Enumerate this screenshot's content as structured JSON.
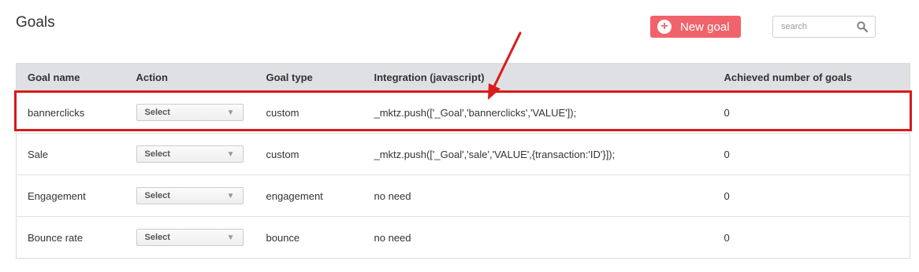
{
  "header": {
    "title": "Goals",
    "new_goal_label": "New goal",
    "search_placeholder": "search"
  },
  "table": {
    "columns": [
      "Goal name",
      "Action",
      "Goal type",
      "Integration (javascript)",
      "Achieved number of goals"
    ],
    "rows": [
      {
        "name": "bannerclicks",
        "action": "Select",
        "type": "custom",
        "integration": "_mktz.push(['_Goal','bannerclicks','VALUE']);",
        "achieved": "0"
      },
      {
        "name": "Sale",
        "action": "Select",
        "type": "custom",
        "integration": "_mktz.push(['_Goal','sale','VALUE',{transaction:'ID'}]);",
        "achieved": "0"
      },
      {
        "name": "Engagement",
        "action": "Select",
        "type": "engagement",
        "integration": "no need",
        "achieved": "0"
      },
      {
        "name": "Bounce rate",
        "action": "Select",
        "type": "bounce",
        "integration": "no need",
        "achieved": "0"
      }
    ]
  },
  "colors": {
    "accent": "#f0636b",
    "annotation": "#d81b1b",
    "header_bg": "#dee0e3"
  }
}
